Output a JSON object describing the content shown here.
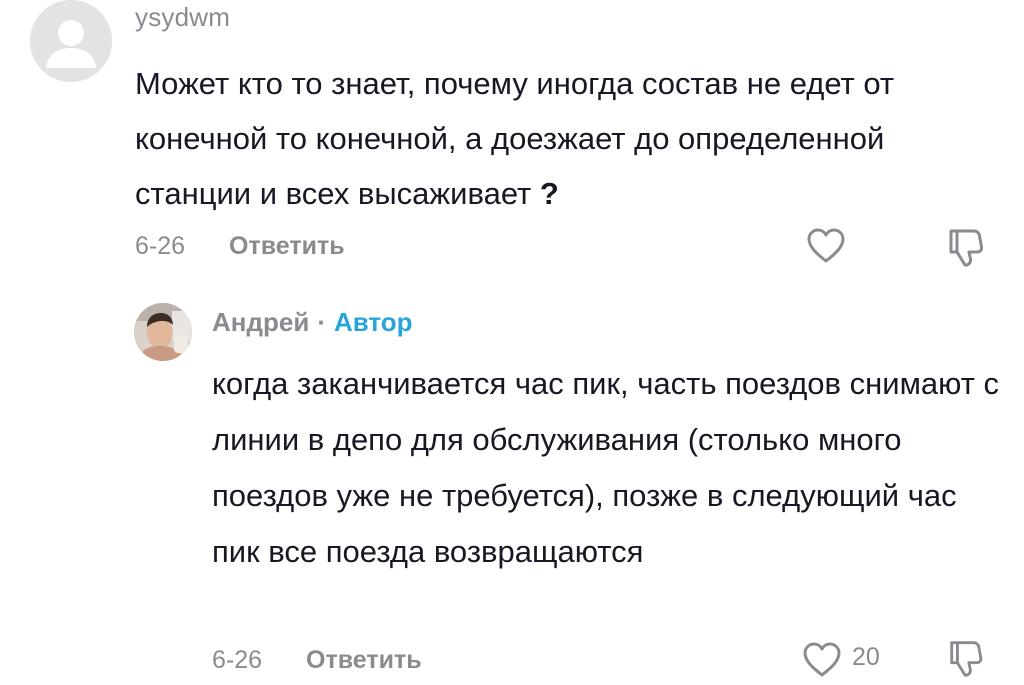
{
  "comment": {
    "username": "ysydwm",
    "text_main": "Может кто то знает, почему иногда состав не едет от конечной то конечной, а доезжает до определенной станции и всех высаживает",
    "text_end": " ?",
    "date": "6-26",
    "reply_label": "Ответить",
    "avatar_icon": "default-avatar-icon",
    "like_icon": "heart-outline-icon",
    "dislike_icon": "thumbs-down-icon"
  },
  "reply": {
    "username": "Андрей",
    "separator": "·",
    "badge": "Автор",
    "text": "когда заканчивается час пик, часть поездов снимают с линии в депо для обслуживания (столько много поездов уже не требуется), позже в следующий час пик все поезда возвращаются",
    "date": "6-26",
    "reply_label": "Ответить",
    "like_count": "20",
    "like_icon": "heart-outline-icon",
    "dislike_icon": "thumbs-down-icon"
  },
  "colors": {
    "text_primary": "#161823",
    "text_secondary": "#8a8b91",
    "author_badge": "#28a5d8",
    "background": "#ffffff"
  }
}
